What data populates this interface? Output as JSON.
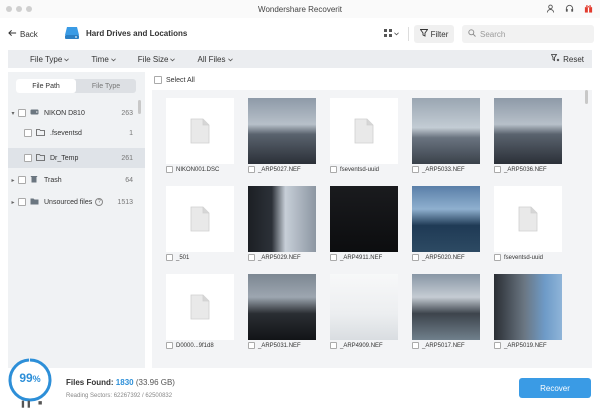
{
  "window": {
    "title": "Wondershare Recoverit"
  },
  "toolbar": {
    "back_label": "Back",
    "location_title": "Hard Drives and Locations",
    "filter_label": "Filter",
    "search_placeholder": "Search"
  },
  "filter_bar": {
    "items": [
      "File Type",
      "Time",
      "File Size",
      "All Files"
    ],
    "reset_label": "Reset"
  },
  "sidebar": {
    "tabs": [
      "File Path",
      "File Type"
    ],
    "active_tab": "File Path",
    "tree": [
      {
        "label": "NIKON D810",
        "count": "263"
      },
      {
        "label": ".fseventsd",
        "count": "1"
      },
      {
        "label": "Dr_Temp",
        "count": "261"
      },
      {
        "label": "Trash",
        "count": "64"
      },
      {
        "label": "Unsourced files",
        "count": "1513"
      }
    ]
  },
  "main": {
    "select_all_label": "Select All",
    "files": [
      {
        "name": "NIKON001.DSC",
        "kind": "doc"
      },
      {
        "name": "_ARP5027.NEF",
        "kind": "photo",
        "tone": "dusk-lake"
      },
      {
        "name": "fseventsd-uuid",
        "kind": "doc"
      },
      {
        "name": "_ARP5033.NEF",
        "kind": "photo",
        "tone": "pier-lake"
      },
      {
        "name": "_ARP5036.NEF",
        "kind": "photo",
        "tone": "dusk-lake"
      },
      {
        "name": "_501",
        "kind": "doc"
      },
      {
        "name": "_ARP5029.NEF",
        "kind": "photo",
        "tone": "cliff"
      },
      {
        "name": "_ARP4911.NEF",
        "kind": "photo",
        "tone": "dark"
      },
      {
        "name": "_ARP5020.NEF",
        "kind": "photo",
        "tone": "blue-lake"
      },
      {
        "name": "fseventsd-uuid",
        "kind": "doc"
      },
      {
        "name": "D0000...9f1d8",
        "kind": "doc"
      },
      {
        "name": "_ARP5031.NEF",
        "kind": "photo",
        "tone": "dusk-hills"
      },
      {
        "name": "_ARP4909.NEF",
        "kind": "photo",
        "tone": "white"
      },
      {
        "name": "_ARP5017.NEF",
        "kind": "photo",
        "tone": "valley"
      },
      {
        "name": "_ARP5019.NEF",
        "kind": "photo",
        "tone": "rock-blue"
      }
    ]
  },
  "status": {
    "progress_percent": "99",
    "progress_suffix": "%",
    "files_found_label": "Files Found:",
    "files_found_count": "1830",
    "files_found_size": "(33.96 GB)",
    "sectors_text": "Reading Sectors: 62267392 / 62500832",
    "recover_label": "Recover"
  },
  "colors": {
    "accent": "#3a9be5",
    "progress": "#2d8fd8"
  }
}
